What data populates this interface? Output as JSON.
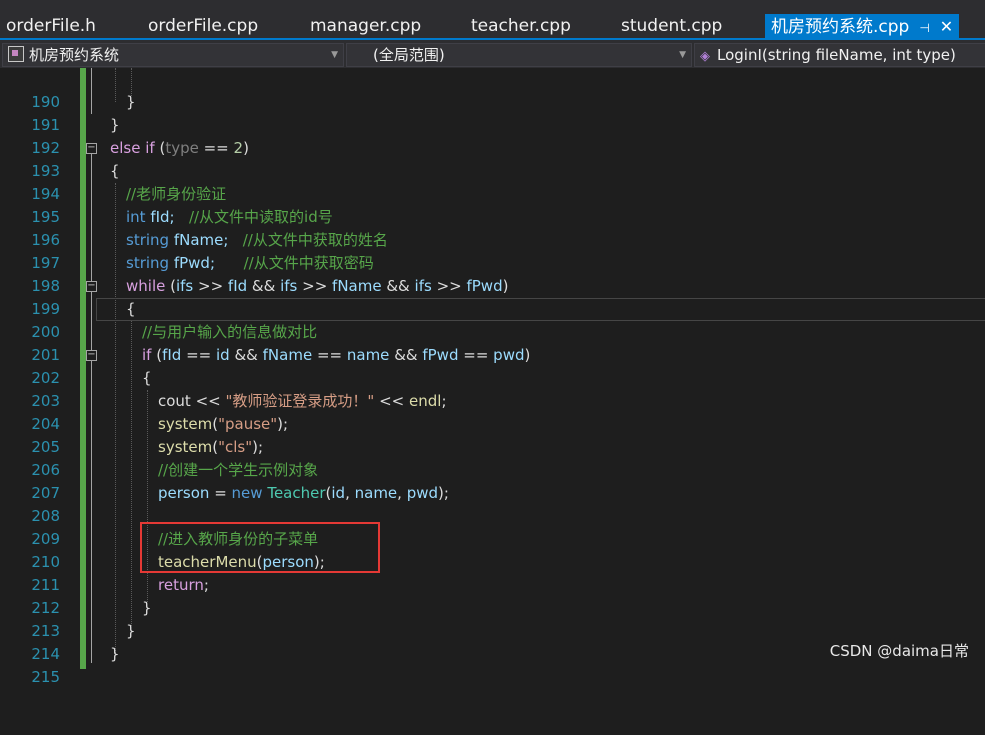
{
  "tabs": [
    {
      "label": "orderFile.h"
    },
    {
      "label": "orderFile.cpp"
    },
    {
      "label": "manager.cpp"
    },
    {
      "label": "teacher.cpp"
    },
    {
      "label": "student.cpp"
    },
    {
      "label": "机房预约系统.cpp",
      "active": true
    }
  ],
  "navbar": {
    "project": "机房预约系统",
    "scope": "(全局范围)",
    "function": "LoginI(string fileName, int type)"
  },
  "editor": {
    "lines": [
      {
        "n": "190"
      },
      {
        "n": "191"
      },
      {
        "n": "192"
      },
      {
        "n": "193"
      },
      {
        "n": "194"
      },
      {
        "n": "195"
      },
      {
        "n": "196"
      },
      {
        "n": "197"
      },
      {
        "n": "198"
      },
      {
        "n": "199"
      },
      {
        "n": "200"
      },
      {
        "n": "201"
      },
      {
        "n": "202"
      },
      {
        "n": "203"
      },
      {
        "n": "204"
      },
      {
        "n": "205"
      },
      {
        "n": "206"
      },
      {
        "n": "207"
      },
      {
        "n": "208"
      },
      {
        "n": "209"
      },
      {
        "n": "210"
      },
      {
        "n": "211"
      },
      {
        "n": "212"
      },
      {
        "n": "213"
      },
      {
        "n": "214"
      },
      {
        "n": "215"
      }
    ],
    "tokens": {
      "t191": "}",
      "t192": "}",
      "t193_else": "else",
      "t193_if": "if",
      "t193_open": " (",
      "t193_type": "type",
      "t193_eq": " == ",
      "t193_num": "2",
      "t193_close": ")",
      "t194": "{",
      "t195": "//老师身份验证",
      "t196_int": "int",
      "t196_rest": " fId;",
      "t196_cm": "//从文件中读取的id号",
      "t197_string": "string",
      "t197_var": " fName;",
      "t197_cm": "//从文件中获取的姓名",
      "t198_string": "string",
      "t198_var": " fPwd;",
      "t198_cm": "//从文件中获取密码",
      "t199_while": "while",
      "t199_open": " (",
      "t199_ifs1": "ifs",
      "t199_op1": " >> ",
      "t199_fid": "fId",
      "t199_and1": " && ",
      "t199_ifs2": "ifs",
      "t199_op2": " >> ",
      "t199_fname": "fName",
      "t199_and2": " && ",
      "t199_ifs3": "ifs",
      "t199_op3": " >> ",
      "t199_fpwd": "fPwd",
      "t199_close": ")",
      "t200": "{",
      "t201": "//与用户输入的信息做对比",
      "t202_if": "if",
      "t202_open": " (",
      "t202_fid": "fId",
      "t202_eq1": " == ",
      "t202_id": "id",
      "t202_and1": " && ",
      "t202_fname": "fName",
      "t202_eq2": " == ",
      "t202_name": "name",
      "t202_and2": " && ",
      "t202_fpwd": "fPwd",
      "t202_eq3": " == ",
      "t202_pwd": "pwd",
      "t202_close": ")",
      "t203": "{",
      "t204_cout": "cout",
      "t204_op1": " << ",
      "t204_str": "\"教师验证登录成功！\"",
      "t204_op2": " << ",
      "t204_endl": "endl",
      "t204_semi": ";",
      "t205_fn": "system",
      "t205_open": "(",
      "t205_str": "\"pause\"",
      "t205_close": ");",
      "t206_fn": "system",
      "t206_open": "(",
      "t206_str": "\"cls\"",
      "t206_close": ");",
      "t207": "//创建一个学生示例对象",
      "t208_person": "person",
      "t208_eq": " = ",
      "t208_new": "new",
      "t208_sp": " ",
      "t208_type": "Teacher",
      "t208_open": "(",
      "t208_id": "id",
      "t208_c1": ", ",
      "t208_name": "name",
      "t208_c2": ", ",
      "t208_pwd": "pwd",
      "t208_close": ");",
      "t210": "//进入教师身份的子菜单",
      "t211_fn": "teacherMenu",
      "t211_open": "(",
      "t211_person": "person",
      "t211_close": ");",
      "t212": "return",
      "t212_semi": ";",
      "t213": "}",
      "t214": "}",
      "t215": "}"
    }
  },
  "watermark": "CSDN @daima日常",
  "colors": {
    "background": "#1e1e1e",
    "tab_active": "#007acc",
    "keyword": "#569cd6",
    "control": "#d8a0df",
    "comment": "#57a64a",
    "string": "#d69d85",
    "variable": "#9cdcfe",
    "function": "#dcdcaa",
    "type": "#4ec9b0",
    "line_number": "#2b91af",
    "highlight_box": "#e53935"
  }
}
